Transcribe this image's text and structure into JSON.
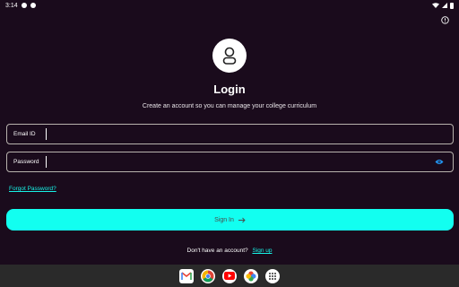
{
  "status_bar": {
    "time": "3:14"
  },
  "login": {
    "title": "Login",
    "subtitle": "Create an account so you can manage your college curriculum"
  },
  "form": {
    "email_label": "Email ID",
    "email_value": "",
    "password_label": "Password",
    "password_value": "",
    "forgot_label": "Forgot Password?",
    "signin_label": "Sign In"
  },
  "footer": {
    "prompt": "Don't have an account?",
    "signup_label": "Sign up"
  },
  "dock": {
    "apps": [
      "gmail-icon",
      "chrome-icon",
      "youtube-icon",
      "photos-icon",
      "app-drawer-icon"
    ]
  },
  "colors": {
    "background": "#1a0b1c",
    "accent": "#12fff0",
    "link": "#17f2e6",
    "eye": "#2196f3"
  }
}
